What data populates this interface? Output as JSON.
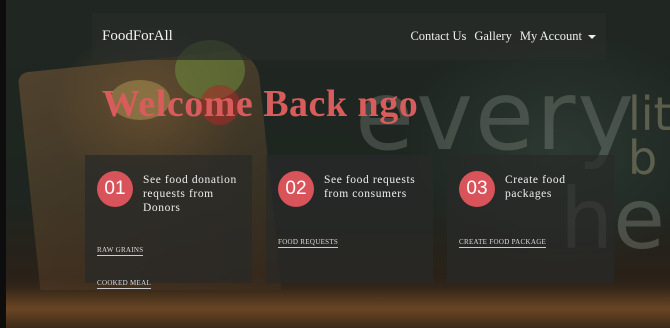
{
  "navbar": {
    "brand": "FoodForAll",
    "links": [
      "Contact Us",
      "Gallery",
      "My Account"
    ]
  },
  "headline": "Welcome Back ngo",
  "background_text": {
    "word1": "every",
    "word2": "help",
    "fragments": [
      "lit",
      "b"
    ]
  },
  "cards": [
    {
      "number": "01",
      "title": "See food donation requests from Donors",
      "links": [
        "RAW GRAINS",
        "COOKED MEAL"
      ]
    },
    {
      "number": "02",
      "title": "See food requests from consumers",
      "links": [
        "FOOD REQUESTS"
      ]
    },
    {
      "number": "03",
      "title": "Create food packages",
      "links": [
        "CREATE FOOD PACKAGE"
      ]
    }
  ],
  "colors": {
    "accent": "#d9545a",
    "headline": "#d85c5c",
    "navbar_bg": "#282c29"
  }
}
